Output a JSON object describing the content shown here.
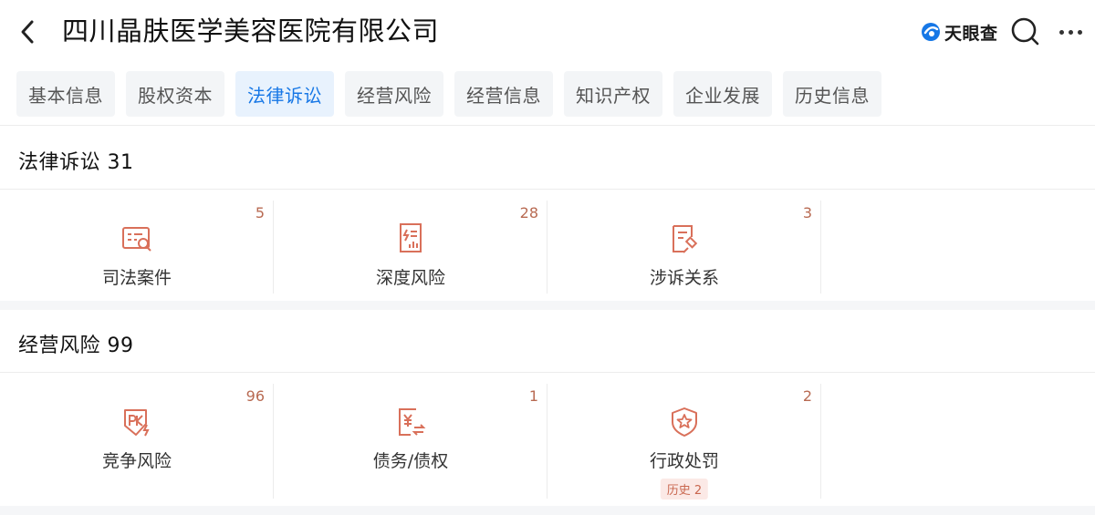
{
  "header": {
    "title": "四川晶肤医学美容医院有限公司",
    "brand": "天眼查",
    "icons": {
      "back": "chevron-left-icon",
      "search": "search-icon",
      "more": "more-icon",
      "brand_logo": "tianyancha-logo"
    }
  },
  "tabs": [
    {
      "label": "基本信息",
      "active": false
    },
    {
      "label": "股权资本",
      "active": false
    },
    {
      "label": "法律诉讼",
      "active": true
    },
    {
      "label": "经营风险",
      "active": false
    },
    {
      "label": "经营信息",
      "active": false
    },
    {
      "label": "知识产权",
      "active": false
    },
    {
      "label": "企业发展",
      "active": false
    },
    {
      "label": "历史信息",
      "active": false
    }
  ],
  "legal": {
    "title": "法律诉讼 31",
    "items": [
      {
        "label": "司法案件",
        "count": "5",
        "icon": "judicial-case-icon"
      },
      {
        "label": "深度风险",
        "count": "28",
        "icon": "deep-risk-icon"
      },
      {
        "label": "涉诉关系",
        "count": "3",
        "icon": "litigation-relation-icon"
      }
    ]
  },
  "operating": {
    "title": "经营风险 99",
    "items": [
      {
        "label": "竞争风险",
        "count": "96",
        "icon": "competition-risk-icon"
      },
      {
        "label": "债务/债权",
        "count": "1",
        "icon": "debt-credit-icon"
      },
      {
        "label": "行政处罚",
        "count": "2",
        "icon": "administrative-penalty-icon",
        "badge": "历史 2"
      }
    ]
  },
  "colors": {
    "accent_blue": "#1677e6",
    "count_color": "#b86a52",
    "icon_red": "#d9705a",
    "badge_bg": "#fbe9e6"
  }
}
